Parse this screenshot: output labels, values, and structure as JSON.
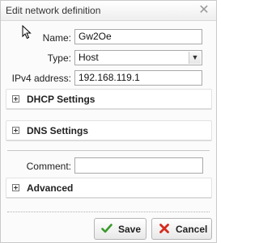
{
  "dialog": {
    "title": "Edit network definition",
    "close_glyph": "✕"
  },
  "form": {
    "name_label": "Name:",
    "name_value": "Gw2Oe",
    "type_label": "Type:",
    "type_value": "Host",
    "ipv4_label": "IPv4 address:",
    "ipv4_value": "192.168.119.1",
    "comment_label": "Comment:",
    "comment_value": ""
  },
  "sections": {
    "dhcp": "DHCP Settings",
    "dns": "DNS Settings",
    "advanced": "Advanced"
  },
  "buttons": {
    "save": "Save",
    "cancel": "Cancel"
  },
  "icons": {
    "close": "close-icon",
    "cursor": "mouse-cursor-icon",
    "dropdown": "chevron-down-icon",
    "expand": "plus-box-icon",
    "save": "checkmark-icon",
    "cancel": "red-x-icon"
  },
  "colors": {
    "save_check": "#3a9a2b",
    "cancel_x": "#d52b1e"
  }
}
